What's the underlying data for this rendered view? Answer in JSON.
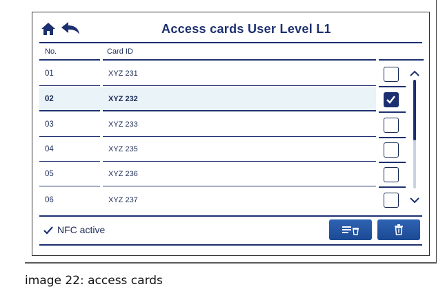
{
  "header": {
    "title": "Access cards User Level L1"
  },
  "table": {
    "columns": [
      "No.",
      "Card ID"
    ],
    "rows": [
      {
        "no": "01",
        "card_id": "XYZ 231",
        "checked": false
      },
      {
        "no": "02",
        "card_id": "XYZ 232",
        "checked": true
      },
      {
        "no": "03",
        "card_id": "XYZ 233",
        "checked": false
      },
      {
        "no": "04",
        "card_id": "XYZ 235",
        "checked": false
      },
      {
        "no": "05",
        "card_id": "XYZ 236",
        "checked": false
      },
      {
        "no": "06",
        "card_id": "XYZ 237",
        "checked": false
      }
    ]
  },
  "footer": {
    "status": "NFC active"
  },
  "caption": "image 22: access cards",
  "icons": [
    "home-icon",
    "back-icon",
    "scroll-up-icon",
    "scroll-down-icon",
    "checkmark-icon",
    "clear-list-icon",
    "trash-icon"
  ],
  "colors": {
    "primary": "#1c2f70",
    "selected_row": "#e9f3f8",
    "button": "#2f62b3"
  }
}
